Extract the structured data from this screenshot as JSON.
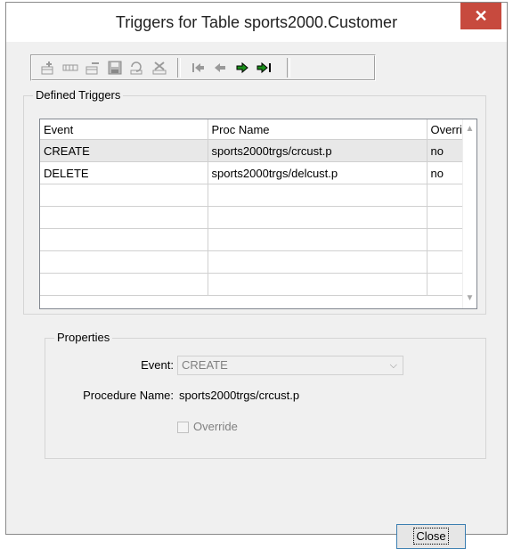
{
  "window": {
    "title": "Triggers for Table sports2000.Customer",
    "close_glyph": "✕"
  },
  "toolbar": {
    "buttons": [
      {
        "name": "add-trigger-icon",
        "glyph": "✚"
      },
      {
        "name": "copy-trigger-icon",
        "glyph": "▭"
      },
      {
        "name": "rename-trigger-icon",
        "glyph": "▭"
      },
      {
        "name": "save-trigger-icon",
        "glyph": "▣"
      },
      {
        "name": "undo-icon",
        "glyph": "↶"
      },
      {
        "name": "delete-trigger-icon",
        "glyph": "✖"
      },
      {
        "name": "first-record-icon",
        "glyph": "⏮"
      },
      {
        "name": "previous-record-icon",
        "glyph": "◀"
      },
      {
        "name": "next-record-icon",
        "glyph": "▶"
      },
      {
        "name": "last-record-icon",
        "glyph": "⏭"
      }
    ]
  },
  "defined_triggers": {
    "label": "Defined Triggers",
    "columns": [
      "Event",
      "Proc Name",
      "Overri"
    ],
    "rows": [
      [
        "CREATE",
        "sports2000trgs/crcust.p",
        "no"
      ],
      [
        "DELETE",
        "sports2000trgs/delcust.p",
        "no"
      ],
      [
        "",
        "",
        ""
      ],
      [
        "",
        "",
        ""
      ],
      [
        "",
        "",
        ""
      ],
      [
        "",
        "",
        ""
      ],
      [
        "",
        "",
        ""
      ]
    ]
  },
  "properties": {
    "label": "Properties",
    "event_label": "Event:",
    "event_value": "CREATE",
    "procedure_label": "Procedure Name:",
    "procedure_value": "sports2000trgs/crcust.p",
    "override_label": "Override"
  },
  "buttons": {
    "close_label": "Close"
  },
  "colors": {
    "title_close_bg": "#c74a3e",
    "next_arrow": "#1a8f1a",
    "last_arrow": "#1a8f1a"
  }
}
